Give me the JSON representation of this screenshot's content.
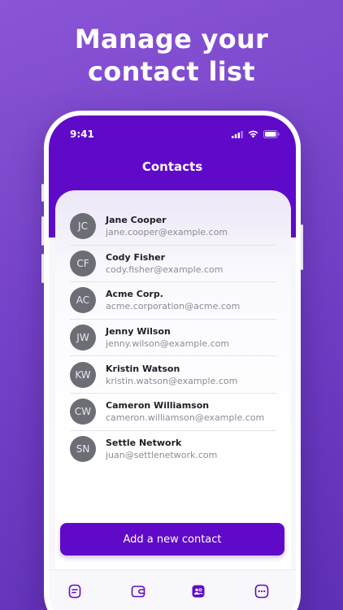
{
  "headline": {
    "line1": "Manage your",
    "line2": "contact list"
  },
  "status_bar": {
    "time": "9:41"
  },
  "screen": {
    "title": "Contacts"
  },
  "contacts": [
    {
      "initials": "JC",
      "name": "Jane Cooper",
      "email": "jane.cooper@example.com"
    },
    {
      "initials": "CF",
      "name": "Cody Fisher",
      "email": "cody.fisher@example.com"
    },
    {
      "initials": "AC",
      "name": "Acme Corp.",
      "email": "acme.corporation@acme.com"
    },
    {
      "initials": "JW",
      "name": "Jenny Wilson",
      "email": "jenny.wilson@example.com"
    },
    {
      "initials": "KW",
      "name": "Kristin Watson",
      "email": "kristin.watson@example.com"
    },
    {
      "initials": "CW",
      "name": "Cameron Williamson",
      "email": "cameron.williamson@example.com"
    },
    {
      "initials": "SN",
      "name": "Settle Network",
      "email": "juan@settlenetwork.com"
    }
  ],
  "add_button": {
    "label": "Add a new contact"
  },
  "tab_bar": {
    "tabs": [
      {
        "icon": "document-icon",
        "active": false
      },
      {
        "icon": "wallet-icon",
        "active": false
      },
      {
        "icon": "contacts-icon",
        "active": true
      },
      {
        "icon": "more-icon",
        "active": false
      }
    ]
  },
  "colors": {
    "background": "#7442c8",
    "accent": "#5f0ac9",
    "avatar": "#6d6e75",
    "text_primary": "#1f1f27",
    "text_secondary": "#8b8b96"
  }
}
